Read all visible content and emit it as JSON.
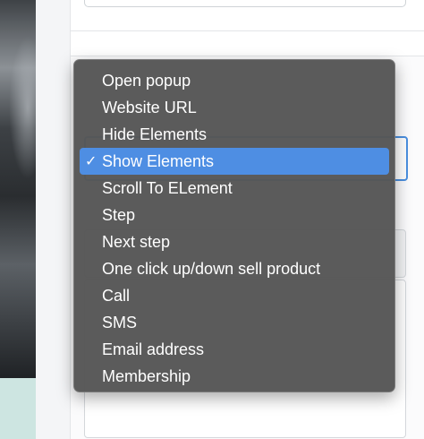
{
  "dropdown": {
    "selected_index": 3,
    "check_glyph": "✓",
    "options": [
      {
        "label": "Open popup"
      },
      {
        "label": "Website URL"
      },
      {
        "label": "Hide Elements"
      },
      {
        "label": "Show Elements"
      },
      {
        "label": "Scroll To ELement"
      },
      {
        "label": "Step"
      },
      {
        "label": "Next step"
      },
      {
        "label": "One click up/down sell product"
      },
      {
        "label": "Call"
      },
      {
        "label": "SMS"
      },
      {
        "label": "Email address"
      },
      {
        "label": "Membership"
      }
    ]
  },
  "colors": {
    "menu_background": "#565656",
    "selection_highlight": "#4e8ee3",
    "select_focus_border": "#4a8fe0",
    "teal_block": "#cde5e1"
  }
}
